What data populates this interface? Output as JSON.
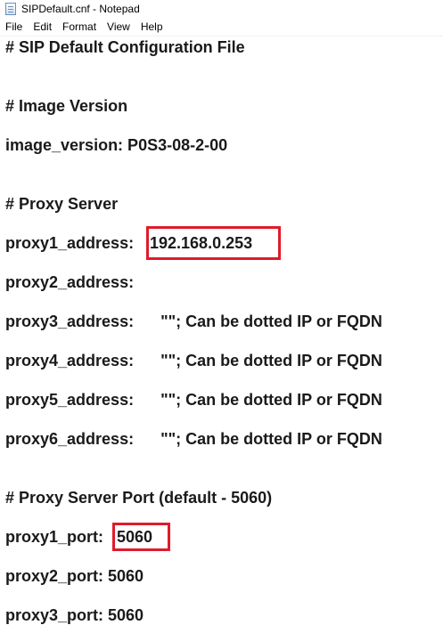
{
  "window": {
    "title": "SIPDefault.cnf - Notepad"
  },
  "menu": [
    "File",
    "Edit",
    "Format",
    "View",
    "Help"
  ],
  "editor": {
    "lines": [
      "# SIP Default Configuration File",
      "# Image Version",
      "image_version: P0S3-08-2-00",
      "# Proxy Server",
      "proxy1_address:",
      "192.168.0.253",
      "proxy2_address:",
      "proxy3_address:      \"\"; Can be dotted IP or FQDN",
      "proxy4_address:      \"\"; Can be dotted IP or FQDN",
      "proxy5_address:      \"\"; Can be dotted IP or FQDN",
      "proxy6_address:      \"\"; Can be dotted IP or FQDN",
      "# Proxy Server Port (default - 5060)",
      "proxy1_port:",
      "5060",
      "proxy2_port: 5060",
      "proxy3_port: 5060"
    ]
  },
  "highlight_color": "#e01b2b"
}
